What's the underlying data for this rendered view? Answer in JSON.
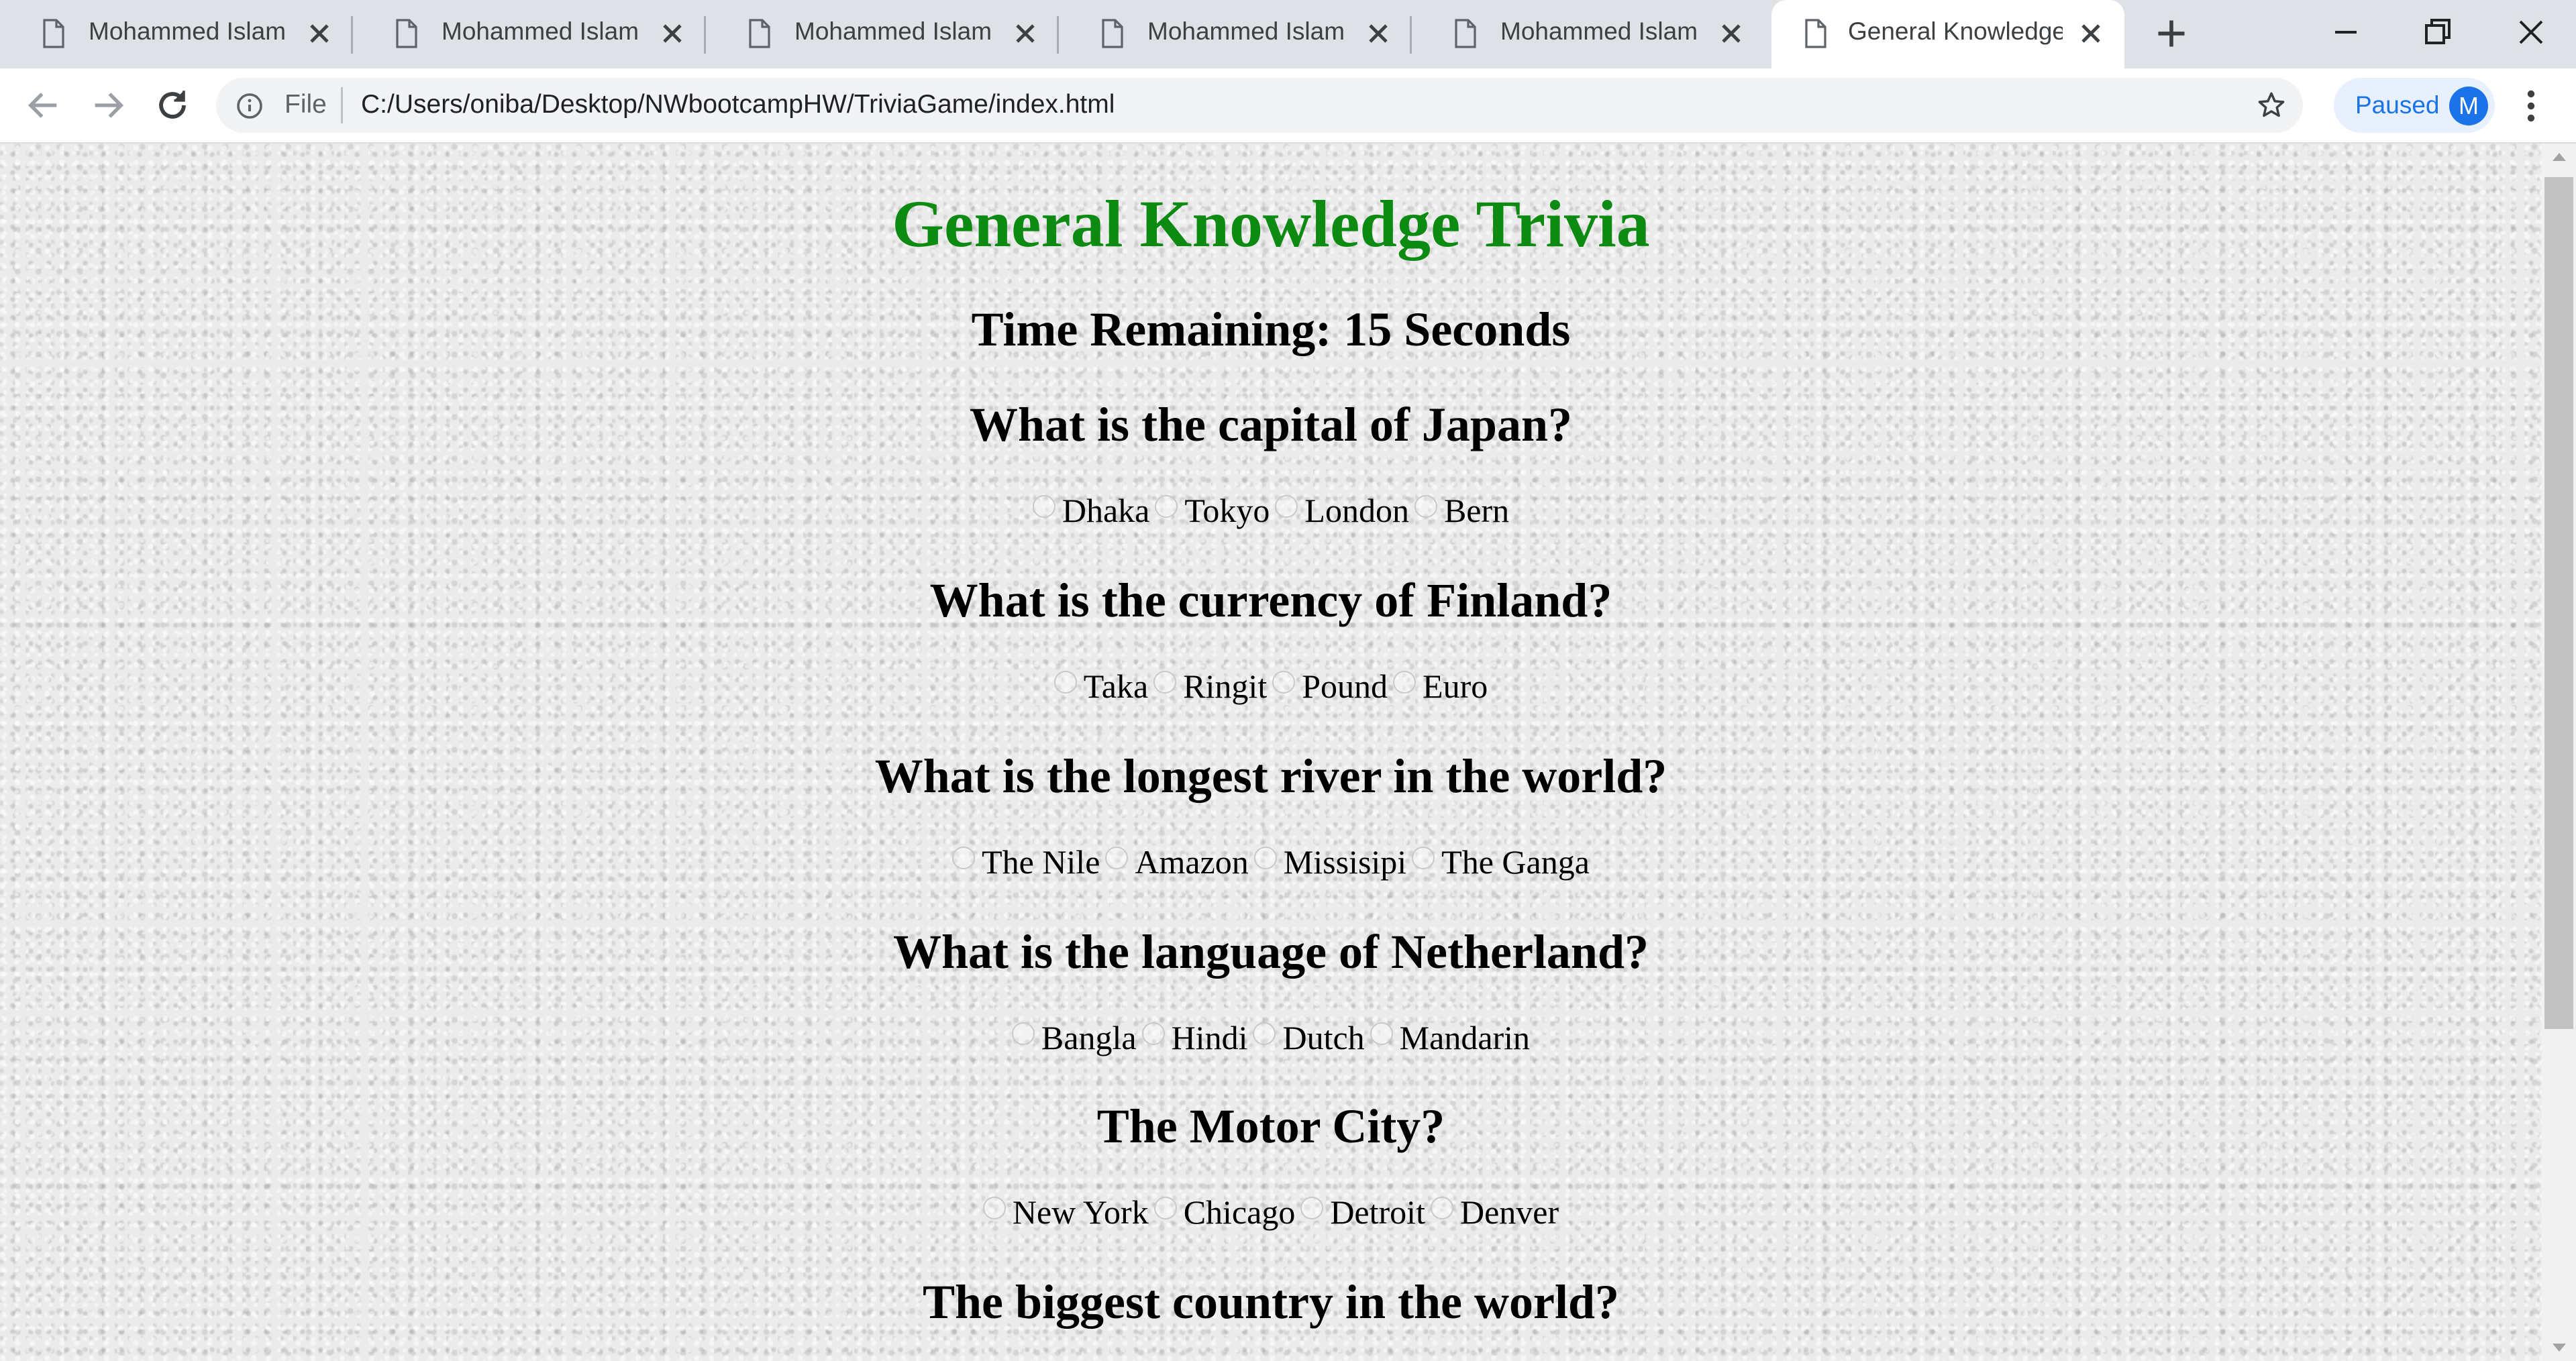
{
  "browser": {
    "tabs": [
      {
        "title": "Mohammed Islam",
        "active": false
      },
      {
        "title": "Mohammed Islam",
        "active": false
      },
      {
        "title": "Mohammed Islam",
        "active": false
      },
      {
        "title": "Mohammed Islam",
        "active": false
      },
      {
        "title": "Mohammed Islam",
        "active": false
      },
      {
        "title": "General Knowledge Trivia",
        "active": true
      }
    ],
    "address": {
      "scheme_label": "File",
      "url": "C:/Users/oniba/Desktop/NWbootcampHW/TriviaGame/index.html"
    },
    "profile": {
      "label": "Paused",
      "initial": "M"
    }
  },
  "page": {
    "title": "General Knowledge Trivia",
    "timer": "Time Remaining: 15 Seconds",
    "questions": [
      {
        "question": "What is the capital of Japan?",
        "answers": [
          "Dhaka",
          "Tokyo",
          "London",
          "Bern"
        ]
      },
      {
        "question": "What is the currency of Finland?",
        "answers": [
          "Taka",
          "Ringit",
          "Pound",
          "Euro"
        ]
      },
      {
        "question": "What is the longest river in the world?",
        "answers": [
          "The Nile",
          "Amazon",
          "Missisipi",
          "The Ganga"
        ]
      },
      {
        "question": "What is the language of Netherland?",
        "answers": [
          "Bangla",
          "Hindi",
          "Dutch",
          "Mandarin"
        ]
      },
      {
        "question": "The Motor City?",
        "answers": [
          "New York",
          "Chicago",
          "Detroit",
          "Denver"
        ]
      },
      {
        "question": "The biggest country in the world?",
        "answers": []
      }
    ]
  },
  "colors": {
    "title_green": "#0d8a12",
    "tabstrip": "#dee1e6",
    "accent_blue": "#1a73e8"
  }
}
